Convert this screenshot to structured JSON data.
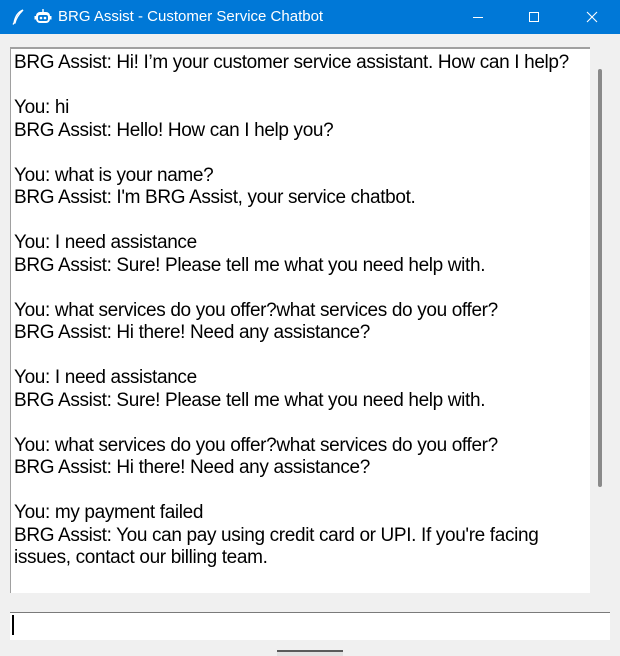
{
  "window": {
    "title": "BRG Assist - Customer Service Chatbot",
    "app_icon": "feather-icon",
    "bot_icon": "robot-icon",
    "accent_color": "#0078d7",
    "controls": {
      "minimize_icon": "minimize-icon",
      "maximize_icon": "maximize-icon",
      "close_icon": "close-icon"
    }
  },
  "chat": {
    "lines": [
      "BRG Assist: Hi! I’m your customer service assistant. How can I help?",
      "",
      "You: hi",
      "BRG Assist: Hello! How can I help you?",
      "",
      "You: what is your name?",
      "BRG Assist: I'm BRG Assist, your service chatbot.",
      "",
      "You: I need assistance",
      "BRG Assist: Sure! Please tell me what you need help with.",
      "",
      "You: what services do you offer?what services do you offer?",
      "BRG Assist: Hi there! Need any assistance?",
      "",
      "You: I need assistance",
      "BRG Assist: Sure! Please tell me what you need help with.",
      "",
      "You: what services do you offer?what services do you offer?",
      "BRG Assist: Hi there! Need any assistance?",
      "",
      "You: my payment failed",
      "BRG Assist: You can pay using credit card or UPI. If you're facing issues, contact our billing team."
    ]
  },
  "input": {
    "value": ""
  }
}
